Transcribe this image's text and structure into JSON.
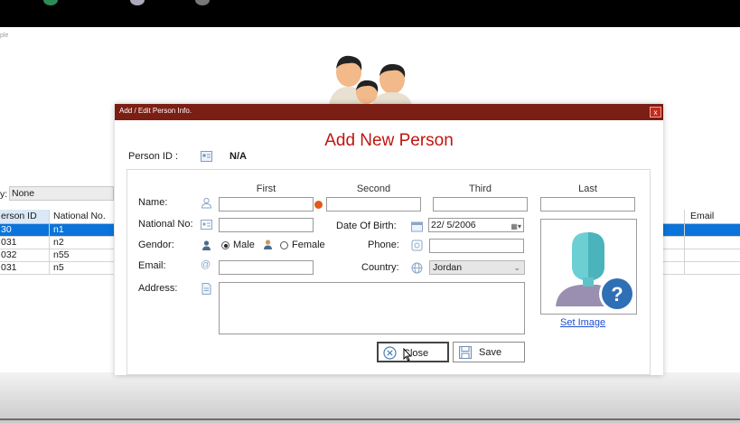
{
  "background": {
    "caption": "ple",
    "filter": {
      "label": "y:",
      "value": "None"
    },
    "left_table": {
      "headers": [
        "erson ID",
        "National No."
      ],
      "rows": [
        [
          "30",
          "n1"
        ],
        [
          "031",
          "n2"
        ],
        [
          "032",
          "n55"
        ],
        [
          "031",
          "n5"
        ]
      ],
      "selected_row": 0
    },
    "right_table": {
      "header": "Email",
      "row_count": 4
    }
  },
  "dialog": {
    "title": "Add / Edit Person Info.",
    "close_glyph": "x",
    "heading": "Add New Person",
    "person_id_label": "Person ID :",
    "person_id_value": "N/A",
    "name_columns": [
      "First",
      "Second",
      "Third",
      "Last"
    ],
    "labels": {
      "name": "Name:",
      "national_no": "National No:",
      "gender": "Gendor:",
      "email": "Email:",
      "address": "Address:",
      "date_of_birth": "Date Of Birth:",
      "phone": "Phone:",
      "country": "Country:"
    },
    "fields": {
      "first": "",
      "second": "",
      "third": "",
      "last": "",
      "national_no": "",
      "email": "",
      "phone": "",
      "address": ""
    },
    "date_of_birth": "22/ 5/2006",
    "gender_options": [
      "Male",
      "Female"
    ],
    "gender_selected": "Male",
    "country": "Jordan",
    "set_image_link": "Set Image",
    "buttons": {
      "close": "Close",
      "save": "Save"
    }
  },
  "colors": {
    "title_bar": "#7b1e14",
    "heading": "#c0150f",
    "selection": "#0a74da",
    "error_icon": "#e05a1b",
    "link": "#1f4fd6"
  },
  "icons": [
    "person-card-icon",
    "user-outline-icon",
    "error-icon",
    "id-card-icon",
    "calendar-icon",
    "male-icon",
    "female-icon",
    "phone-icon",
    "at-sign-icon",
    "globe-icon",
    "document-icon",
    "close-circle-icon",
    "save-disk-icon",
    "unknown-person-icon",
    "question-mark-icon",
    "people-group-icon",
    "dropdown-arrow-icon"
  ]
}
